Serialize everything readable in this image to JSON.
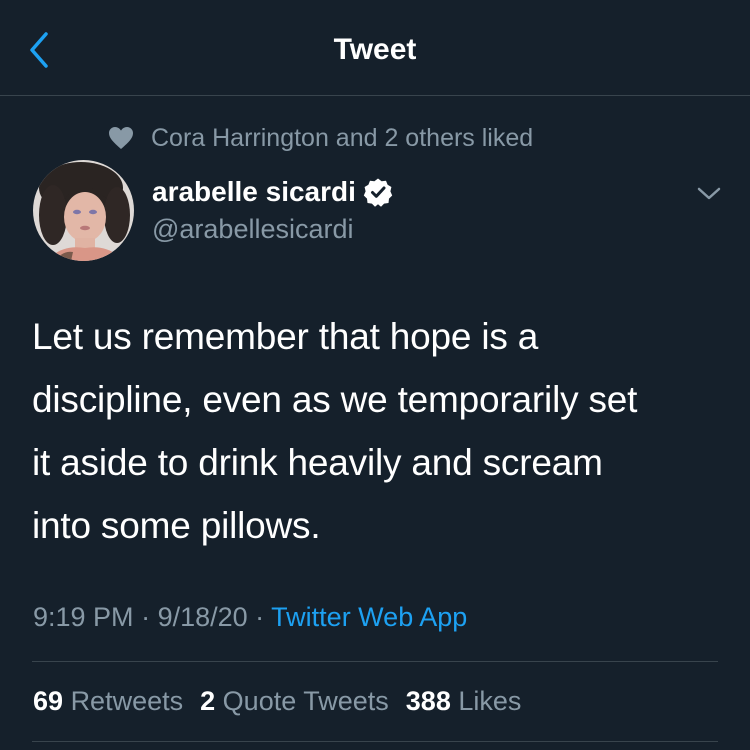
{
  "header": {
    "title": "Tweet",
    "back_icon": "chevron-left-icon"
  },
  "social_context": {
    "icon": "heart-icon",
    "text": "Cora Harrington and 2 others liked"
  },
  "author": {
    "display_name": "arabelle sicardi",
    "handle": "@arabellesicardi",
    "verified": true
  },
  "tweet": {
    "text": "Let us remember that hope is a\ndiscipline, even as we temporarily set\nit aside to drink heavily and scream\ninto some pillows.",
    "time": "9:19 PM",
    "sep1": " · ",
    "date": "9/18/20",
    "sep2": " · ",
    "source": "Twitter Web App"
  },
  "stats": {
    "retweets_count": "69",
    "retweets_label": "Retweets",
    "quotes_count": "2",
    "quotes_label": "Quote Tweets",
    "likes_count": "388",
    "likes_label": "Likes"
  },
  "colors": {
    "background": "#15202b",
    "accent": "#1da1f2",
    "secondary_text": "#8899a6",
    "divider": "#38444d"
  }
}
